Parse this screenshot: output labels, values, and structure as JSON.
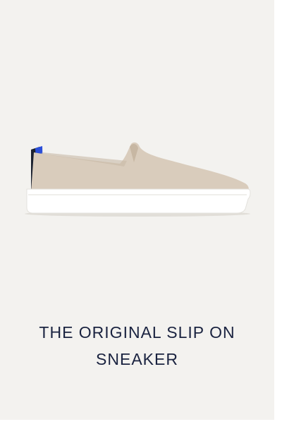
{
  "product": {
    "title": "THE ORIGINAL SLIP ON\nSNEAKER",
    "image_icon": "slip-on-sneaker-image"
  },
  "colors": {
    "card_background": "#f3f2ef",
    "title_text": "#1a2340",
    "upper": "#d9ccbc",
    "sole": "#ffffff",
    "heel_tab": "#2b4fd8"
  }
}
